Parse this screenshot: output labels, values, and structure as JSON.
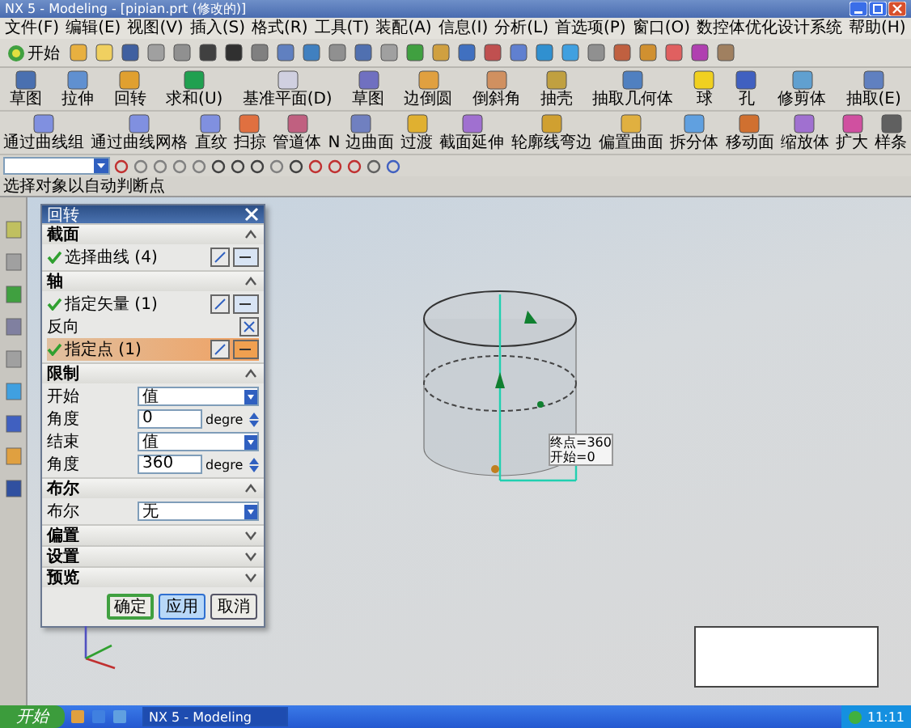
{
  "window": {
    "title": "NX 5 - Modeling - [pipian.prt (修改的)]"
  },
  "menu": [
    "文件(F)",
    "编辑(E)",
    "视图(V)",
    "插入(S)",
    "格式(R)",
    "工具(T)",
    "装配(A)",
    "信息(I)",
    "分析(L)",
    "首选项(P)",
    "窗口(O)",
    "数控体优化设计系统",
    "帮助(H)"
  ],
  "standard_toolbar": {
    "start_label": "开始"
  },
  "ribbon_rows": [
    [
      "草图",
      "拉伸",
      "回转",
      "求和(U)",
      "基准平面(D)",
      "草图",
      "边倒圆",
      "倒斜角",
      "抽壳",
      "抽取几何体",
      "球",
      "孔",
      "修剪体",
      "抽取(E)"
    ],
    [
      "通过曲线组",
      "通过曲线网格",
      "直纹",
      "扫掠",
      "管道体",
      "N 边曲面",
      "过渡",
      "截面延伸",
      "轮廓线弯边",
      "偏置曲面",
      "拆分体",
      "移动面",
      "缩放体",
      "扩大",
      "样条"
    ]
  ],
  "status_bar": "选择对象以自动判断点",
  "dialog": {
    "title": "回转",
    "sections": [
      {
        "title": "截面",
        "expanded": true,
        "rows": [
          {
            "kind": "selection",
            "label": "选择曲线 (4)",
            "highlighted": false
          }
        ]
      },
      {
        "title": "轴",
        "expanded": true,
        "rows": [
          {
            "kind": "selection",
            "label": "指定矢量 (1)",
            "highlighted": false
          },
          {
            "kind": "toggle",
            "label": "反向"
          },
          {
            "kind": "selection",
            "label": "指定点 (1)",
            "highlighted": true
          }
        ]
      },
      {
        "title": "限制",
        "expanded": true,
        "rows": [
          {
            "kind": "dropdown",
            "label": "开始",
            "value": "值"
          },
          {
            "kind": "number",
            "label": "角度",
            "value": "0",
            "unit": "degre"
          },
          {
            "kind": "dropdown",
            "label": "结束",
            "value": "值"
          },
          {
            "kind": "number",
            "label": "角度",
            "value": "360",
            "unit": "degre"
          }
        ]
      },
      {
        "title": "布尔",
        "expanded": true,
        "rows": [
          {
            "kind": "dropdown",
            "label": "布尔",
            "value": "无"
          }
        ]
      },
      {
        "title": "偏置",
        "expanded": false
      },
      {
        "title": "设置",
        "expanded": false
      },
      {
        "title": "预览",
        "expanded": false
      }
    ],
    "buttons": [
      {
        "label": "确定",
        "default": true,
        "hovered": false
      },
      {
        "label": "应用",
        "default": false,
        "hovered": true
      },
      {
        "label": "取消",
        "default": false,
        "hovered": false
      }
    ]
  },
  "viewport": {
    "labels": [
      "终点=360",
      "开始=0"
    ]
  },
  "taskbar": {
    "start": "开始",
    "tasks": [
      {
        "label": "NX 5 - Modeling",
        "selected": true
      }
    ],
    "clock": "11:11"
  }
}
